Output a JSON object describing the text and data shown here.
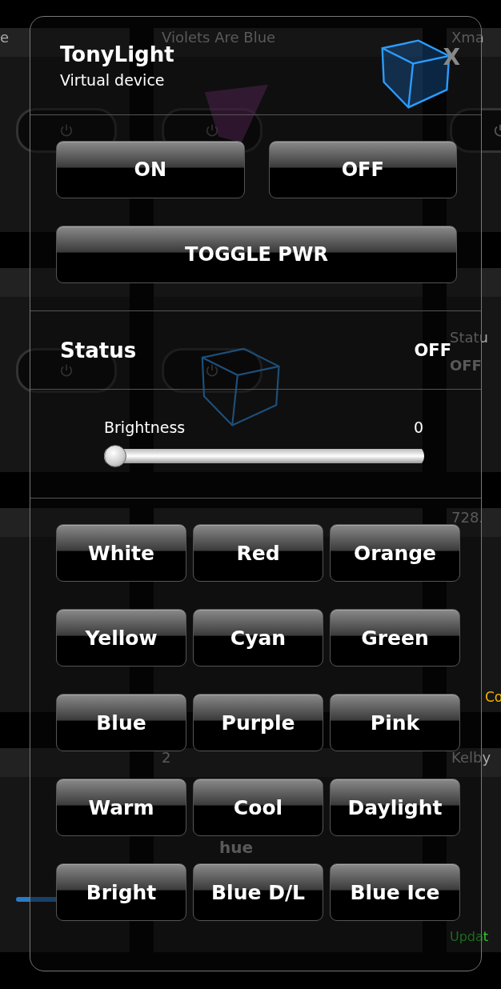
{
  "background_tiles": [
    {
      "title": "e",
      "kind": "switch",
      "on": false
    },
    {
      "title": "Violets Are Blue",
      "kind": "switch",
      "on": false
    },
    {
      "title": "Xma",
      "kind": "switch",
      "on": false
    },
    {
      "kind": "switch",
      "on": false
    },
    {
      "kind": "switch",
      "on": false
    },
    {
      "kind": "info",
      "texts": [
        {
          "text": "Statu",
          "kind": "label"
        },
        {
          "text": "OFF",
          "kind": "value"
        }
      ]
    },
    {
      "kind": "blank"
    },
    {
      "kind": "blank"
    },
    {
      "title": "728.",
      "kind": "info",
      "texts": [
        {
          "text": "Co",
          "kind": "warning"
        }
      ]
    },
    {
      "kind": "slider"
    },
    {
      "title": "2",
      "kind": "info",
      "texts": [
        {
          "text": "hue",
          "kind": "caption"
        }
      ]
    },
    {
      "title": "Kelby",
      "kind": "info",
      "texts": [
        {
          "text": "Updat",
          "kind": "ok"
        }
      ]
    }
  ],
  "dialog": {
    "title": "TonyLight",
    "subtitle": "Virtual device",
    "close": "X",
    "power_buttons": [
      "ON",
      "OFF"
    ],
    "toggle_button": "TOGGLE PWR",
    "status": {
      "label": "Status",
      "value": "OFF"
    },
    "brightness": {
      "label": "Brightness",
      "reading": "0",
      "level": 0
    },
    "color_buttons": [
      "White",
      "Red",
      "Orange",
      "Yellow",
      "Cyan",
      "Green",
      "Blue",
      "Purple",
      "Pink",
      "Warm",
      "Cool",
      "Daylight",
      "Bright",
      "Blue D/L",
      "Blue Ice"
    ]
  }
}
